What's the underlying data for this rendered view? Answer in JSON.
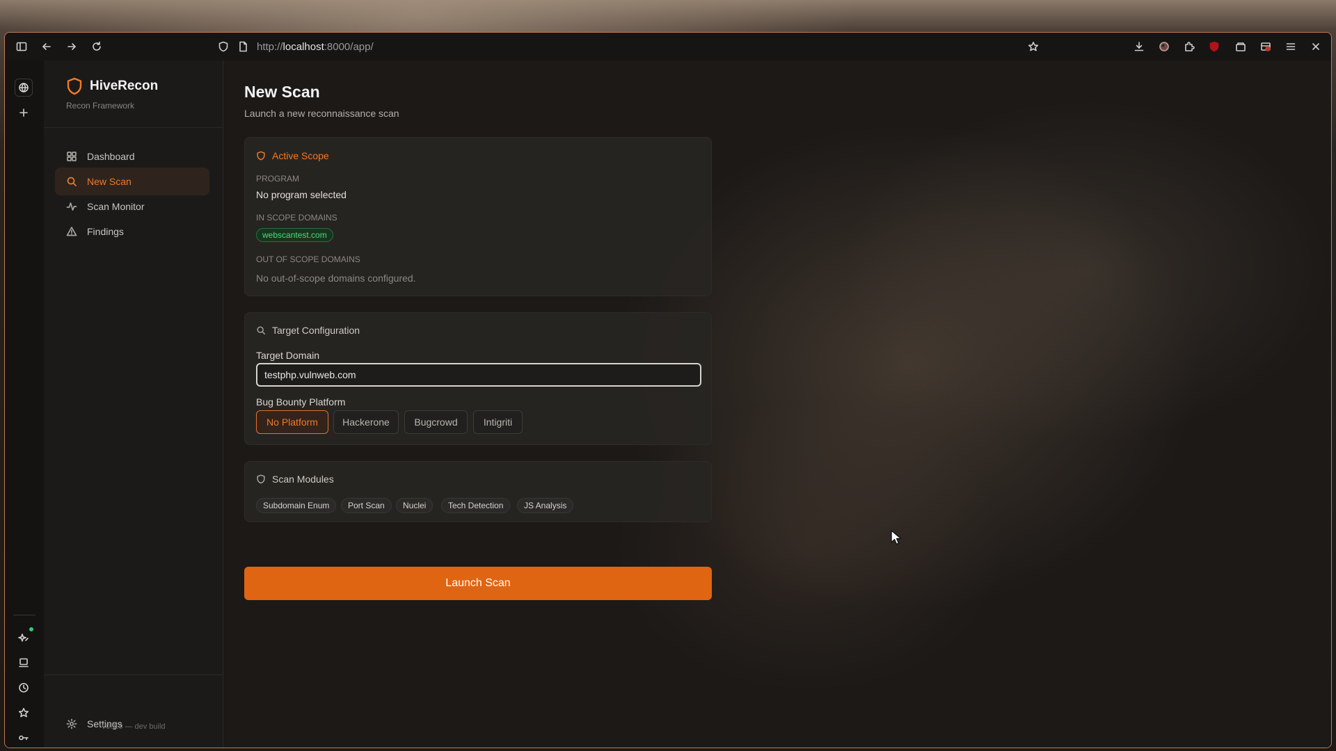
{
  "browser": {
    "url_prefix": "http://",
    "url_host": "localhost",
    "url_rest": ":8000/app/"
  },
  "sidebar": {
    "brand_title": "HiveRecon",
    "brand_subtitle": "Recon Framework",
    "items": [
      {
        "label": "Dashboard",
        "icon": "dashboard-icon",
        "active": false
      },
      {
        "label": "New Scan",
        "icon": "search-icon",
        "active": true
      },
      {
        "label": "Scan Monitor",
        "icon": "activity-icon",
        "active": false
      },
      {
        "label": "Findings",
        "icon": "alert-triangle-icon",
        "active": false
      }
    ],
    "settings_label": "Settings",
    "version": "v0.1.0 — dev build"
  },
  "page": {
    "title": "New Scan",
    "subtitle": "Launch a new reconnaissance scan"
  },
  "scope": {
    "heading": "Active Scope",
    "program_label": "Program",
    "program_value": "No program selected",
    "in_scope_label": "In Scope Domains",
    "in_scope_domains": [
      "webscantest.com"
    ],
    "out_scope_label": "Out of Scope Domains",
    "out_scope_empty": "No out-of-scope domains configured."
  },
  "target": {
    "heading": "Target Configuration",
    "domain_label": "Target Domain",
    "domain_value": "testphp.vulnweb.com",
    "platform_label": "Bug Bounty Platform",
    "platforms": [
      "No Platform",
      "Hackerone",
      "Bugcrowd",
      "Intigriti"
    ],
    "selected_platform": "No Platform"
  },
  "modules": {
    "heading": "Scan Modules",
    "items": [
      "Subdomain Enum",
      "Port Scan",
      "Nuclei",
      "Tech Detection",
      "JS Analysis"
    ]
  },
  "launch_label": "Launch Scan",
  "colors": {
    "accent": "#f07a2a",
    "launch_bg": "#e06512",
    "in_scope_green": "#4fdc78"
  }
}
